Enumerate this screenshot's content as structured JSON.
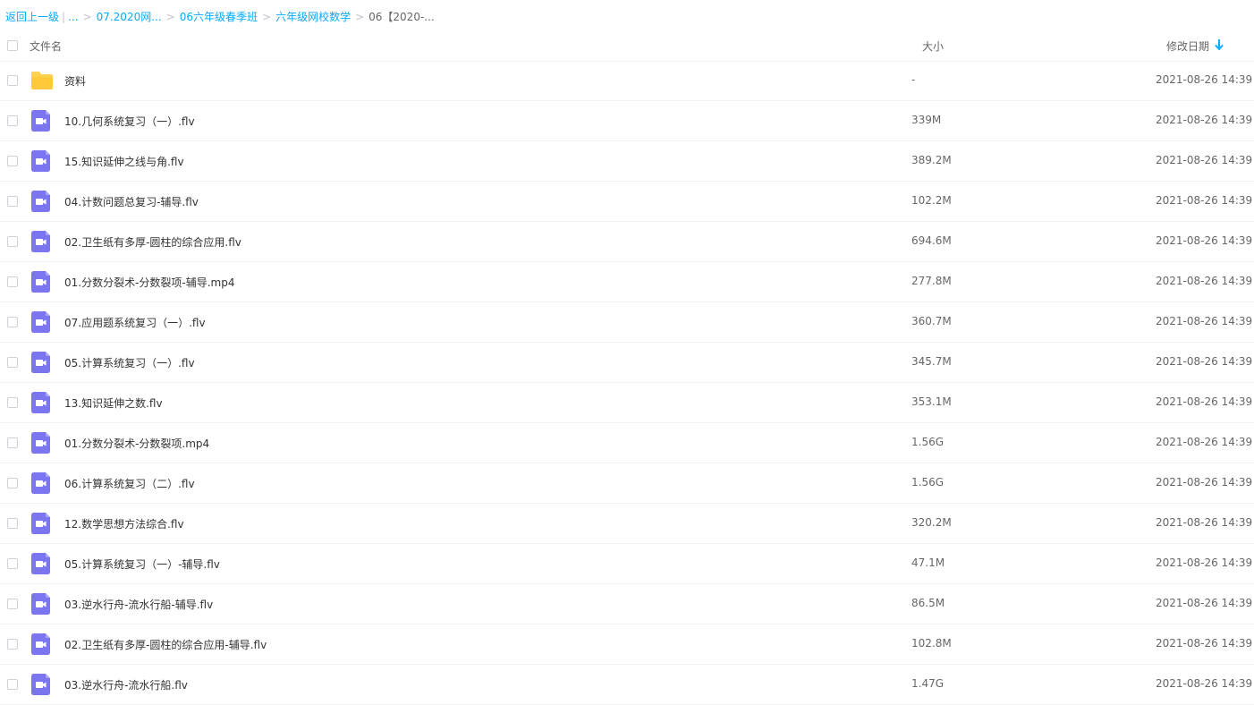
{
  "breadcrumb": {
    "back": "返回上一级",
    "ellipsis": "...",
    "items": [
      "07.2020网...",
      "06六年级春季班",
      "六年级网校数学"
    ],
    "current": "06【2020-..."
  },
  "table": {
    "headers": {
      "name": "文件名",
      "size": "大小",
      "date": "修改日期"
    },
    "sort": {
      "column": "date",
      "direction": "descending",
      "icon": "arrow-down-icon"
    },
    "rows": [
      {
        "type": "folder",
        "icon": "folder-icon",
        "name": "资料",
        "size": "-",
        "date": "2021-08-26 14:39"
      },
      {
        "type": "video",
        "icon": "video-file-icon",
        "name": "10.几何系统复习（一）.flv",
        "size": "339M",
        "date": "2021-08-26 14:39"
      },
      {
        "type": "video",
        "icon": "video-file-icon",
        "name": "15.知识延伸之线与角.flv",
        "size": "389.2M",
        "date": "2021-08-26 14:39"
      },
      {
        "type": "video",
        "icon": "video-file-icon",
        "name": "04.计数问题总复习-辅导.flv",
        "size": "102.2M",
        "date": "2021-08-26 14:39"
      },
      {
        "type": "video",
        "icon": "video-file-icon",
        "name": "02.卫生纸有多厚-圆柱的综合应用.flv",
        "size": "694.6M",
        "date": "2021-08-26 14:39"
      },
      {
        "type": "video",
        "icon": "video-file-icon",
        "name": "01.分数分裂术-分数裂项-辅导.mp4",
        "size": "277.8M",
        "date": "2021-08-26 14:39"
      },
      {
        "type": "video",
        "icon": "video-file-icon",
        "name": "07.应用题系统复习（一）.flv",
        "size": "360.7M",
        "date": "2021-08-26 14:39"
      },
      {
        "type": "video",
        "icon": "video-file-icon",
        "name": "05.计算系统复习（一）.flv",
        "size": "345.7M",
        "date": "2021-08-26 14:39"
      },
      {
        "type": "video",
        "icon": "video-file-icon",
        "name": "13.知识延伸之数.flv",
        "size": "353.1M",
        "date": "2021-08-26 14:39"
      },
      {
        "type": "video",
        "icon": "video-file-icon",
        "name": "01.分数分裂术-分数裂项.mp4",
        "size": "1.56G",
        "date": "2021-08-26 14:39"
      },
      {
        "type": "video",
        "icon": "video-file-icon",
        "name": "06.计算系统复习（二）.flv",
        "size": "1.56G",
        "date": "2021-08-26 14:39"
      },
      {
        "type": "video",
        "icon": "video-file-icon",
        "name": "12.数学思想方法综合.flv",
        "size": "320.2M",
        "date": "2021-08-26 14:39"
      },
      {
        "type": "video",
        "icon": "video-file-icon",
        "name": "05.计算系统复习（一）-辅导.flv",
        "size": "47.1M",
        "date": "2021-08-26 14:39"
      },
      {
        "type": "video",
        "icon": "video-file-icon",
        "name": "03.逆水行舟-流水行船-辅导.flv",
        "size": "86.5M",
        "date": "2021-08-26 14:39"
      },
      {
        "type": "video",
        "icon": "video-file-icon",
        "name": "02.卫生纸有多厚-圆柱的综合应用-辅导.flv",
        "size": "102.8M",
        "date": "2021-08-26 14:39"
      },
      {
        "type": "video",
        "icon": "video-file-icon",
        "name": "03.逆水行舟-流水行船.flv",
        "size": "1.47G",
        "date": "2021-08-26 14:39"
      }
    ]
  },
  "colors": {
    "link": "#09aaff",
    "video_icon": "#7b76f0",
    "folder_icon": "#ffd34d"
  }
}
